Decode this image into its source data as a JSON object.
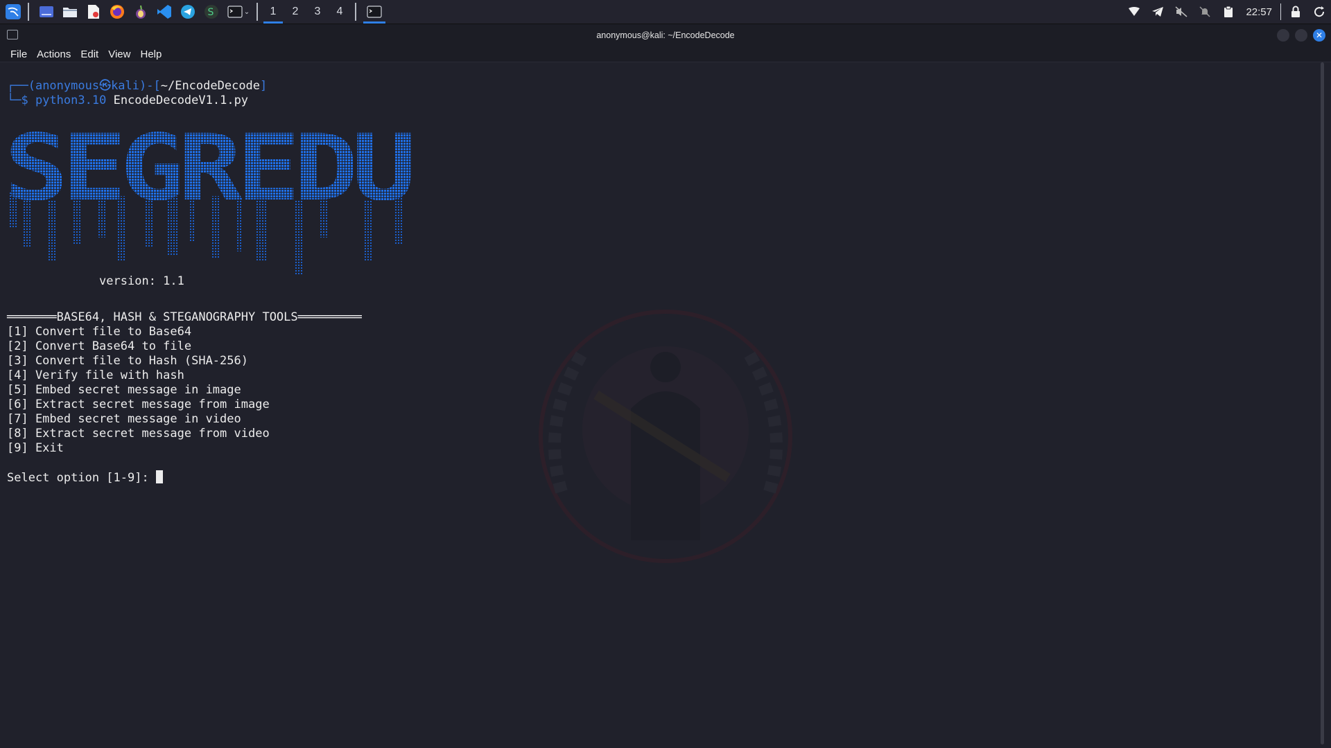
{
  "panel": {
    "launcher_icons": [
      "kali-menu-icon",
      "show-desktop-icon",
      "file-manager-icon",
      "pdf-icon",
      "firefox-icon",
      "tor-icon",
      "vscode-icon",
      "telegram-icon",
      "app-icon",
      "terminal-icon"
    ],
    "workspaces": [
      "1",
      "2",
      "3",
      "4"
    ],
    "active_workspace": "1",
    "clock": "22:57"
  },
  "window": {
    "title": "anonymous@kali: ~/EncodeDecode"
  },
  "menu": [
    "File",
    "Actions",
    "Edit",
    "View",
    "Help"
  ],
  "terminal": {
    "prompt_open": "┌──(",
    "user": "anonymous㉿kali",
    "prompt_mid": ")-[",
    "path": "~/EncodeDecode",
    "prompt_close": "]",
    "prompt_line2": "└─$",
    "command": "python3.10",
    "argument": "EncodeDecodeV1.1.py",
    "banner_text": "SEGREDU",
    "version_line": "             version: 1.1",
    "header_line": "═══════BASE64, HASH & STEGANOGRAPHY TOOLS═════════",
    "options": [
      "[1] Convert file to Base64",
      "[2] Convert Base64 to file",
      "[3] Convert file to Hash (SHA-256)",
      "[4] Verify file with hash",
      "[5] Embed secret message in image",
      "[6] Extract secret message from image",
      "[7] Embed secret message in video",
      "[8] Extract secret message from video",
      "[9] Exit"
    ],
    "select_prompt": "Select option [1-9]: "
  },
  "colors": {
    "accent": "#2f7fe6",
    "banner": "#1f6fe8",
    "background": "#20212b"
  }
}
